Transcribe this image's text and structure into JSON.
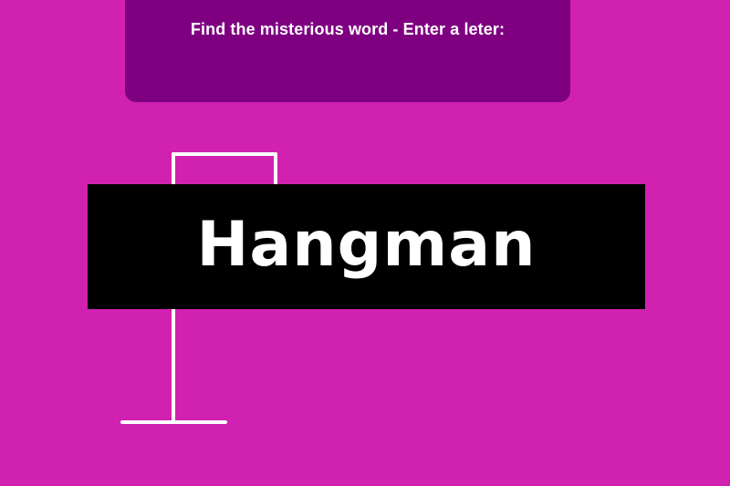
{
  "prompt": {
    "text": "Find the misterious word - Enter a leter:"
  },
  "title": {
    "text": "Hangman"
  },
  "colors": {
    "background": "#d021b1",
    "panel": "#7e0081",
    "banner": "#000000",
    "gallows": "#ffffff"
  }
}
